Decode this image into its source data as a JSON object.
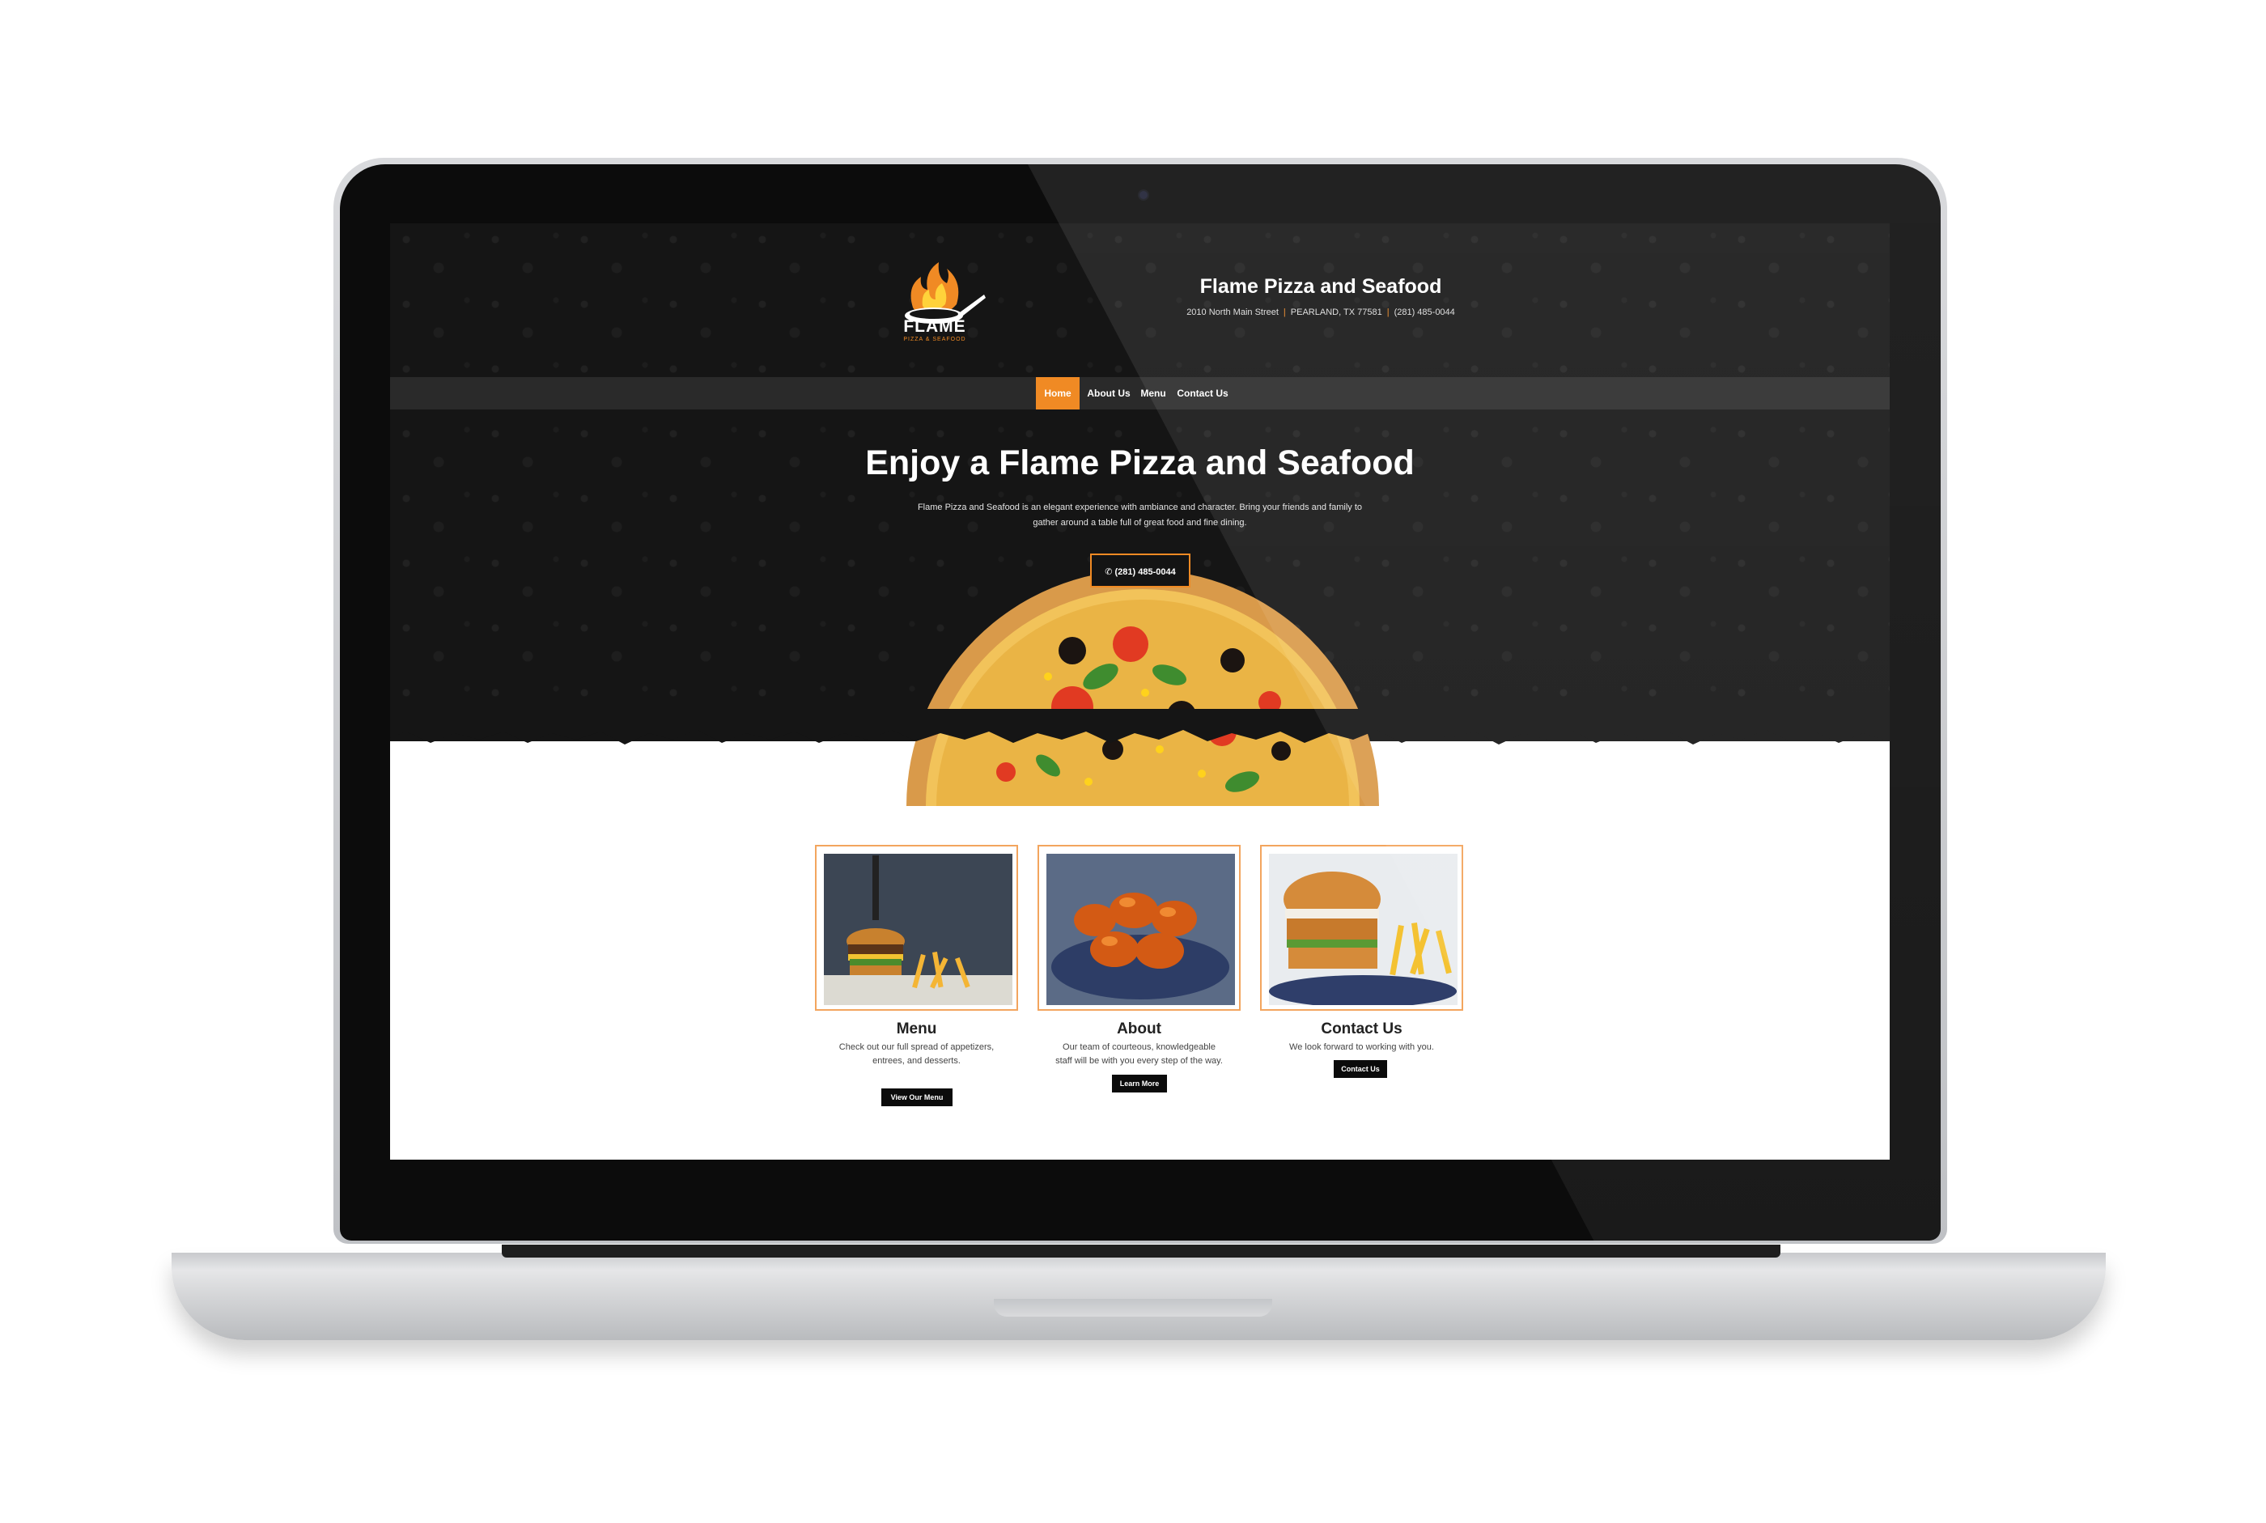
{
  "site": {
    "title": "Flame Pizza and Seafood",
    "address": "2010 North Main Street",
    "city": "PEARLAND, TX 77581",
    "phone": "(281) 485-0044",
    "logo": {
      "word": "FLAME",
      "sub": "PIZZA & SEAFOOD",
      "icon": "flame-pan-icon"
    }
  },
  "nav": {
    "items": [
      {
        "label": "Home",
        "active": true
      },
      {
        "label": "About Us",
        "active": false
      },
      {
        "label": "Menu",
        "active": false
      },
      {
        "label": "Contact Us",
        "active": false
      }
    ]
  },
  "hero": {
    "title": "Enjoy a Flame Pizza and Seafood",
    "description": "Flame Pizza and Seafood is an elegant experience with ambiance and character. Bring your friends and family to gather around a table full of great food and fine dining.",
    "button": {
      "label": "(281) 485-0044",
      "icon": "phone-icon"
    }
  },
  "cards": [
    {
      "title": "Menu",
      "text": "Check out our full spread of appetizers, entrees, and desserts.",
      "button": "View Our Menu",
      "image": "burger-and-fries-photo"
    },
    {
      "title": "About",
      "text": "Our team of courteous, knowledgeable staff will be with you every step of the way.",
      "button": "Learn More",
      "image": "glazed-shrimp-photo"
    },
    {
      "title": "Contact Us",
      "text": "We look forward to working with you.",
      "button": "Contact Us",
      "image": "chicken-sandwich-photo"
    }
  ],
  "colors": {
    "accent": "#f08a24",
    "dark_bg": "#151515",
    "nav_bg": "#2a2a2a",
    "button": "#0b0b0b"
  }
}
